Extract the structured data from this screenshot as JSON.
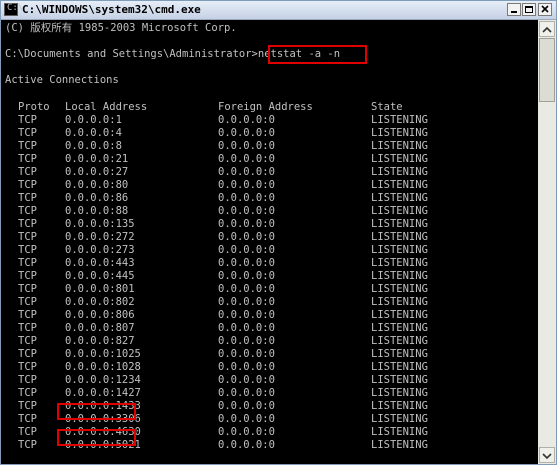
{
  "window": {
    "title": "C:\\WINDOWS\\system32\\cmd.exe",
    "icon_text": "C:\\"
  },
  "console": {
    "copyright": "(C) 版权所有 1985-2003 Microsoft Corp.",
    "prompt": "C:\\Documents and Settings\\Administrator>",
    "command": "netstat -a -n",
    "section_title": "Active Connections",
    "headers": [
      "Proto",
      "Local Address",
      "Foreign Address",
      "State"
    ],
    "rows": [
      [
        "TCP",
        "0.0.0.0:1",
        "0.0.0.0:0",
        "LISTENING"
      ],
      [
        "TCP",
        "0.0.0.0:4",
        "0.0.0.0:0",
        "LISTENING"
      ],
      [
        "TCP",
        "0.0.0.0:8",
        "0.0.0.0:0",
        "LISTENING"
      ],
      [
        "TCP",
        "0.0.0.0:21",
        "0.0.0.0:0",
        "LISTENING"
      ],
      [
        "TCP",
        "0.0.0.0:27",
        "0.0.0.0:0",
        "LISTENING"
      ],
      [
        "TCP",
        "0.0.0.0:80",
        "0.0.0.0:0",
        "LISTENING"
      ],
      [
        "TCP",
        "0.0.0.0:86",
        "0.0.0.0:0",
        "LISTENING"
      ],
      [
        "TCP",
        "0.0.0.0:88",
        "0.0.0.0:0",
        "LISTENING"
      ],
      [
        "TCP",
        "0.0.0.0:135",
        "0.0.0.0:0",
        "LISTENING"
      ],
      [
        "TCP",
        "0.0.0.0:272",
        "0.0.0.0:0",
        "LISTENING"
      ],
      [
        "TCP",
        "0.0.0.0:273",
        "0.0.0.0:0",
        "LISTENING"
      ],
      [
        "TCP",
        "0.0.0.0:443",
        "0.0.0.0:0",
        "LISTENING"
      ],
      [
        "TCP",
        "0.0.0.0:445",
        "0.0.0.0:0",
        "LISTENING"
      ],
      [
        "TCP",
        "0.0.0.0:801",
        "0.0.0.0:0",
        "LISTENING"
      ],
      [
        "TCP",
        "0.0.0.0:802",
        "0.0.0.0:0",
        "LISTENING"
      ],
      [
        "TCP",
        "0.0.0.0:806",
        "0.0.0.0:0",
        "LISTENING"
      ],
      [
        "TCP",
        "0.0.0.0:807",
        "0.0.0.0:0",
        "LISTENING"
      ],
      [
        "TCP",
        "0.0.0.0:827",
        "0.0.0.0:0",
        "LISTENING"
      ],
      [
        "TCP",
        "0.0.0.0:1025",
        "0.0.0.0:0",
        "LISTENING"
      ],
      [
        "TCP",
        "0.0.0.0:1028",
        "0.0.0.0:0",
        "LISTENING"
      ],
      [
        "TCP",
        "0.0.0.0:1234",
        "0.0.0.0:0",
        "LISTENING"
      ],
      [
        "TCP",
        "0.0.0.0:1427",
        "0.0.0.0:0",
        "LISTENING"
      ],
      [
        "TCP",
        "0.0.0.0:1433",
        "0.0.0.0:0",
        "LISTENING"
      ],
      [
        "TCP",
        "0.0.0.0:3306",
        "0.0.0.0:0",
        "LISTENING"
      ],
      [
        "TCP",
        "0.0.0.0:4630",
        "0.0.0.0:0",
        "LISTENING"
      ],
      [
        "TCP",
        "0.0.0.0:5021",
        "0.0.0.0:0",
        "LISTENING"
      ]
    ],
    "highlighted_ports": [
      "0.0.0.0:1433",
      "0.0.0.0:4630"
    ]
  },
  "colors": {
    "console_bg": "#000000",
    "console_text": "#c0c0c0",
    "highlight_box": "#e00000"
  }
}
